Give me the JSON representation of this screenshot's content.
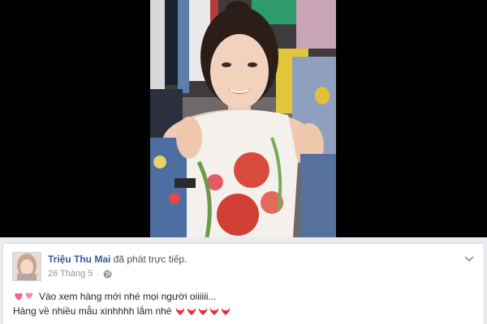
{
  "post": {
    "author": "Triệu Thu Mai",
    "action": " đã phát trực tiếp.",
    "date": "26 Tháng 5",
    "separator": "·",
    "line1": "Vào xem hàng mới nhé mọi người oiiiiii...",
    "line2": "Hàng về nhiều mẫu xinhhhh lắm nhé"
  },
  "icons": {
    "globe": "globe-icon",
    "menu": "chevron-down-icon",
    "hearts": "two-hearts-emoji",
    "bikini": "bikini-emoji"
  },
  "colors": {
    "author_link": "#365899",
    "meta_text": "#90949c",
    "video_bg": "#000000",
    "heart_pink": "#f0648c",
    "bikini_red": "#e0314a"
  }
}
